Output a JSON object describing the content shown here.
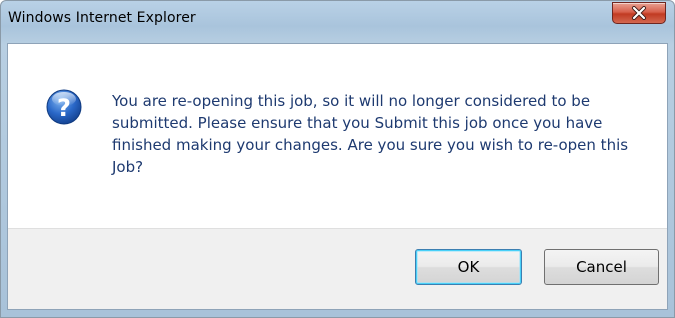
{
  "window": {
    "title": "Windows Internet Explorer",
    "close_icon": "close-icon"
  },
  "message": {
    "icon": "question-icon",
    "text": "You are re-opening this job, so it will no longer considered to be submitted. Please ensure that you Submit this job once you have finished making your changes. Are you sure you wish to re-open this Job?"
  },
  "buttons": {
    "ok_label": "OK",
    "cancel_label": "Cancel"
  },
  "colors": {
    "message_text": "#1e3a70",
    "close_button": "#c13a22",
    "frame": "#a9c4dc",
    "button_area": "#f0f0f0"
  }
}
